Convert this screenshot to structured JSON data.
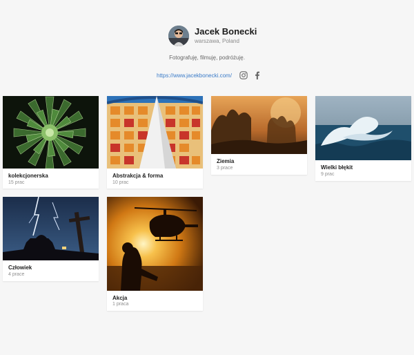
{
  "profile": {
    "name": "Jacek Bonecki",
    "location": "warszawa, Poland",
    "bio": "Fotografuję, filmuję, podróżuję.",
    "website": "https://www.jacekbonecki.com/",
    "social_icons": [
      "instagram-icon",
      "facebook-icon"
    ]
  },
  "albums": [
    {
      "title": "kolekcjonerska",
      "count": "15 prac"
    },
    {
      "title": "Abstrakcja & forma",
      "count": "10 prac"
    },
    {
      "title": "Ziemia",
      "count": "3 prace"
    },
    {
      "title": "Wielki błękit",
      "count": "9 prac"
    },
    {
      "title": "Człowiek",
      "count": "4 prace"
    },
    {
      "title": "Akcja",
      "count": "1 praca"
    }
  ],
  "colors": {
    "background": "#f6f6f6",
    "link": "#3a7bc8",
    "card": "#ffffff"
  }
}
